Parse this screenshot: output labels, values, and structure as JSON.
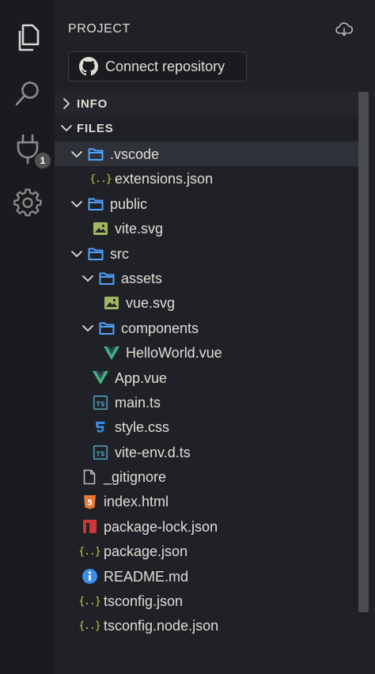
{
  "activity_bar": {
    "items": [
      {
        "name": "explorer",
        "icon": "files-icon",
        "active": true
      },
      {
        "name": "search",
        "icon": "search-icon",
        "active": false
      },
      {
        "name": "extensions",
        "icon": "plug-icon",
        "active": false,
        "badge": "1"
      },
      {
        "name": "settings",
        "icon": "gear-icon",
        "active": false
      }
    ]
  },
  "sidebar": {
    "title": "PROJECT",
    "connect_button": "Connect repository",
    "sections": {
      "info": "INFO",
      "files": "FILES"
    },
    "tree": [
      {
        "label": ".vscode",
        "type": "folder",
        "depth": 0,
        "expanded": true,
        "selected": true
      },
      {
        "label": "extensions.json",
        "type": "json",
        "depth": 1
      },
      {
        "label": "public",
        "type": "folder",
        "depth": 0,
        "expanded": true
      },
      {
        "label": "vite.svg",
        "type": "image",
        "depth": 1
      },
      {
        "label": "src",
        "type": "folder",
        "depth": 0,
        "expanded": true
      },
      {
        "label": "assets",
        "type": "folder",
        "depth": 1,
        "expanded": true
      },
      {
        "label": "vue.svg",
        "type": "image",
        "depth": 2
      },
      {
        "label": "components",
        "type": "folder",
        "depth": 1,
        "expanded": true
      },
      {
        "label": "HelloWorld.vue",
        "type": "vue",
        "depth": 2
      },
      {
        "label": "App.vue",
        "type": "vue",
        "depth": 1
      },
      {
        "label": "main.ts",
        "type": "ts",
        "depth": 1
      },
      {
        "label": "style.css",
        "type": "css",
        "depth": 1
      },
      {
        "label": "vite-env.d.ts",
        "type": "ts",
        "depth": 1
      },
      {
        "label": "_gitignore",
        "type": "file",
        "depth": 0
      },
      {
        "label": "index.html",
        "type": "html",
        "depth": 0
      },
      {
        "label": "package-lock.json",
        "type": "npm",
        "depth": 0
      },
      {
        "label": "package.json",
        "type": "json",
        "depth": 0
      },
      {
        "label": "README.md",
        "type": "info",
        "depth": 0
      },
      {
        "label": "tsconfig.json",
        "type": "json",
        "depth": 0
      },
      {
        "label": "tsconfig.node.json",
        "type": "json",
        "depth": 0
      }
    ]
  },
  "colors": {
    "folder": "#4fa3ff",
    "json": "#cbcb41",
    "image": "#a1b75f",
    "vue": "#41b883",
    "ts": "#519aba",
    "css": "#3b8eea",
    "html": "#e37933",
    "npm": "#cb3837",
    "info": "#3b8eea"
  }
}
